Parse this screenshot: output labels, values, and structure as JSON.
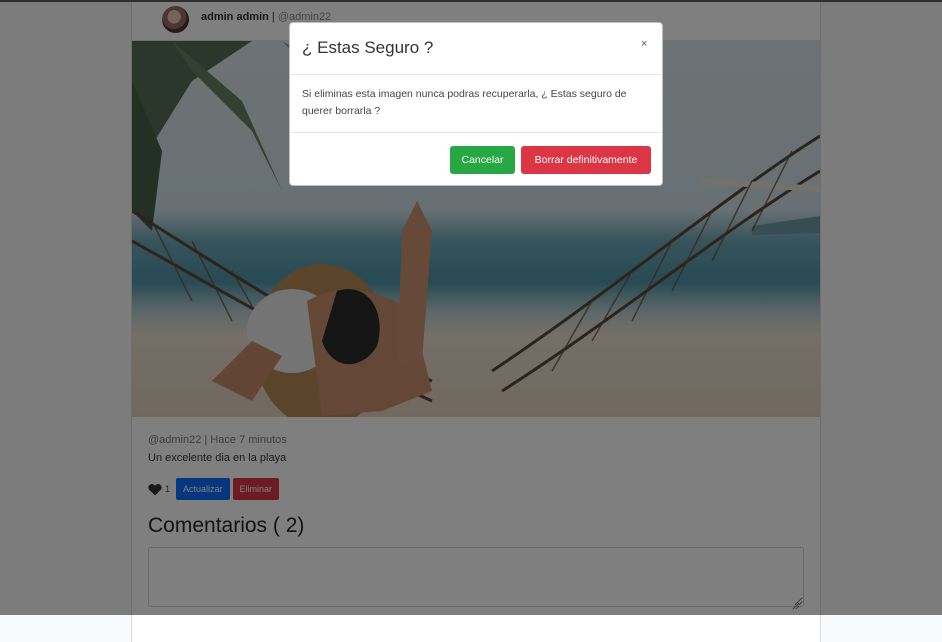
{
  "post": {
    "author_name": "admin admin",
    "separator": " | ",
    "author_handle": "@admin22",
    "meta": "@admin22 | Hace 7 minutos",
    "caption": "Un excelente dia en la playa",
    "like_count": "1",
    "update_label": "Actualizar",
    "delete_label": "Eliminar",
    "image_subject": "beach-hammock-photo"
  },
  "comments": {
    "title": "Comentarios ( 2)",
    "input_value": ""
  },
  "modal": {
    "title": "¿ Estas Seguro ?",
    "close_label": "×",
    "body": "Si eliminas esta imagen nunca podras recuperarla, ¿ Estas seguro de querer borrarla ?",
    "cancel_label": "Cancelar",
    "confirm_label": "Borrar definitivamente"
  },
  "colors": {
    "cancel_green": "#28a745",
    "danger_red": "#dc3545",
    "primary_blue": "#0d6efd"
  },
  "icons": {
    "like": "heart-icon",
    "close": "close-icon",
    "textarea_resize": "resize-grip-icon"
  }
}
